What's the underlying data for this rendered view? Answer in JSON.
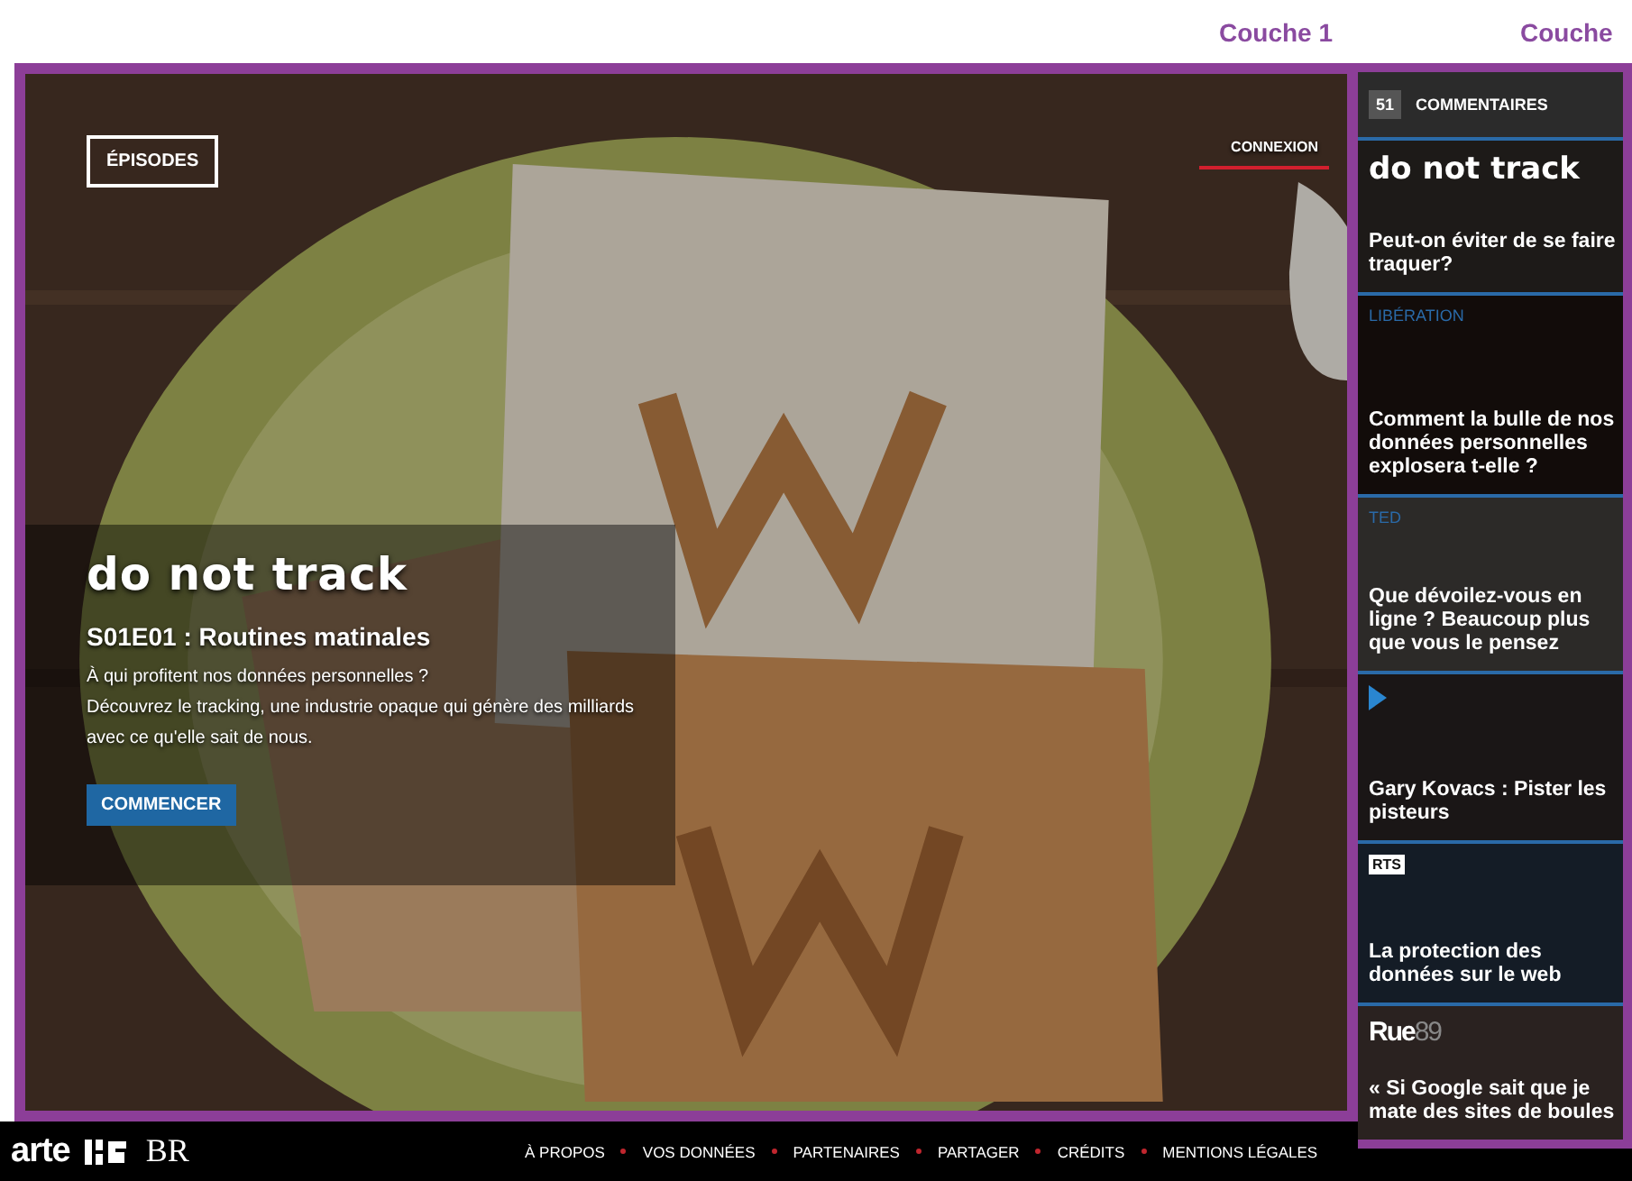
{
  "annotations": [
    "Couche 1",
    "Couche"
  ],
  "hero": {
    "kind": "picture",
    "episodes_button": "ÉPISODES",
    "login_link": "CONNEXION",
    "wordmark": "do not track",
    "episode_title": "S01E01 : Routines matinales",
    "description": [
      "À qui profitent nos données personnelles ?",
      "Découvrez le tracking, une industrie opaque qui génère des milliards",
      "avec ce qu'elle sait de nous."
    ],
    "start_button": "COMMENCER"
  },
  "sidebar": {
    "comment_count": "51",
    "comments_label": "COMMENTAIRES",
    "cards": [
      {
        "kind": "wordmark",
        "source": "do not track",
        "title": "Peut-on éviter de se faire traquer?"
      },
      {
        "kind": "label",
        "source": "LIBÉRATION",
        "title": "Comment la bulle de nos données personnelles explosera t-elle ?"
      },
      {
        "kind": "label",
        "source": "TED",
        "title": "Que dévoilez-vous en ligne ? Beaucoup plus que vous le pensez"
      },
      {
        "kind": "play",
        "title": "Gary Kovacs : Pister les pisteurs"
      },
      {
        "kind": "badge",
        "source": "RTS",
        "title": "La protection des données sur le web"
      },
      {
        "kind": "logo",
        "source": "Rue",
        "source_accent": "89",
        "title": "« Si Google sait que je mate des sites de boules"
      }
    ]
  },
  "footer": {
    "brand": "arte",
    "partner": "BR",
    "links": [
      "À PROPOS",
      "VOS DONNÉES",
      "PARTENAIRES",
      "PARTAGER",
      "CRÉDITS",
      "MENTIONS LÉGALES"
    ]
  }
}
